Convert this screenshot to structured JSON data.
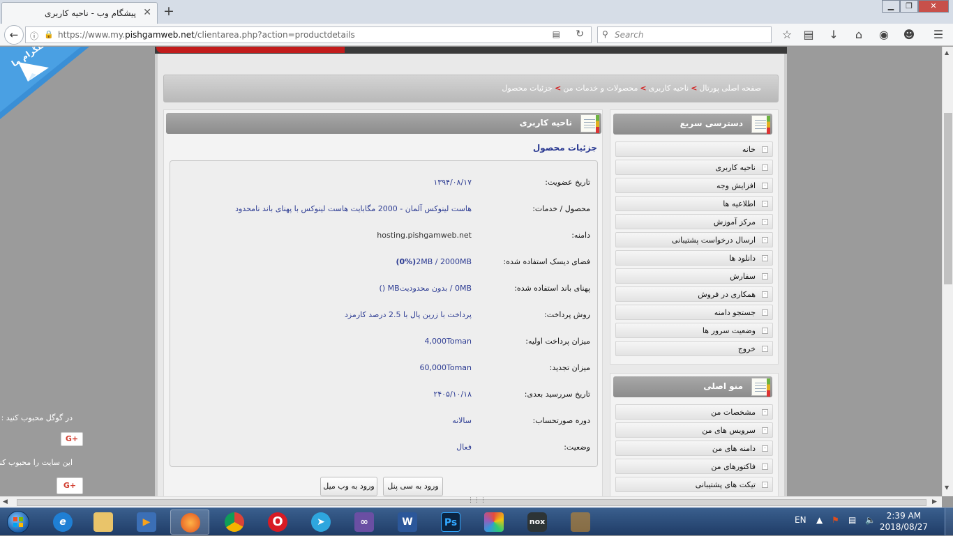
{
  "browser": {
    "tab_title": "پیشگام وب - ناحیه کاربری",
    "tab_close": "✕",
    "new_tab": "+",
    "url_host_pre": "https://www.my.",
    "url_host": "pishgamweb.net",
    "url_path": "/clientarea.php?action=productdetails",
    "search_placeholder": "Search",
    "window_buttons": [
      "▁",
      "❐",
      "✕"
    ]
  },
  "telegram": {
    "label": "کانال تلگرام ما"
  },
  "social": {
    "google_text": "در گوگل محبوب کنید :",
    "site_text": "این سایت را محبوب کنید :",
    "gplus_label": "G+"
  },
  "breadcrumb": {
    "items": [
      "صفحه اصلی پورتال",
      "ناحیه کاربری",
      "محصولات و خدمات من",
      "جزئیات محصول"
    ],
    "separator": ">"
  },
  "quick_access": {
    "title": "دسترسی سریع",
    "items": [
      "خانه",
      "ناحیه کاربری",
      "افزایش وجه",
      "اطلاعیه ها",
      "مرکز آموزش",
      "ارسال درخواست پشتیبانی",
      "دانلود ها",
      "سفارش",
      "همکاری در فروش",
      "جستجو دامنه",
      "وضعیت سرور ها",
      "خروج"
    ]
  },
  "main_menu": {
    "title": "منو اصلی",
    "items": [
      "مشخصات من",
      "سرویس های من",
      "دامنه های من",
      "فاکتورهای من",
      "تیکت های پشتیبانی"
    ]
  },
  "client_area": {
    "title": "ناحیه کاربری",
    "subtitle": "جزئیات محصول",
    "details": [
      {
        "label": "تاریخ عضویت:",
        "value": "۱۳۹۴/۰۸/۱۷"
      },
      {
        "label": "محصول / خدمات:",
        "value": "هاست لینوکس آلمان - 2000 مگابایت هاست لینوکس با پهنای باند نامحدود"
      },
      {
        "label": "دامنه:",
        "value": "hosting.pishgamweb.net"
      },
      {
        "label": "فضای دیسک استفاده شده:",
        "value_pre": "2MB / 2000MB ",
        "value_bold": "(0%)"
      },
      {
        "label": "پهنای باند استفاده شده:",
        "value": "0MB / بدون محدودیتMB ()"
      },
      {
        "label": "روش پرداخت:",
        "value": "پرداخت با زرین پال با 2.5 درصد کارمزد"
      },
      {
        "label": "میزان پرداخت اولیه:",
        "value": "4,000Toman"
      },
      {
        "label": "میزان تجدید:",
        "value": "60,000Toman"
      },
      {
        "label": "تاریخ سررسید بعدی:",
        "value": "۲۴۰۵/۱۰/۱۸"
      },
      {
        "label": "دوره صورتحساب:",
        "value": "سالانه"
      },
      {
        "label": "وضعیت:",
        "value": "فعال"
      }
    ],
    "btn_cpanel": "ورود به سی پنل",
    "btn_webmail": "ورود به وب میل"
  },
  "taskbar": {
    "language": "EN",
    "time": "2:39 AM",
    "date": "2018/08/27"
  },
  "colors": {
    "accent_red": "#c21c1c",
    "link_blue": "#2d3c93",
    "telegram_blue": "#3a8fd6"
  }
}
